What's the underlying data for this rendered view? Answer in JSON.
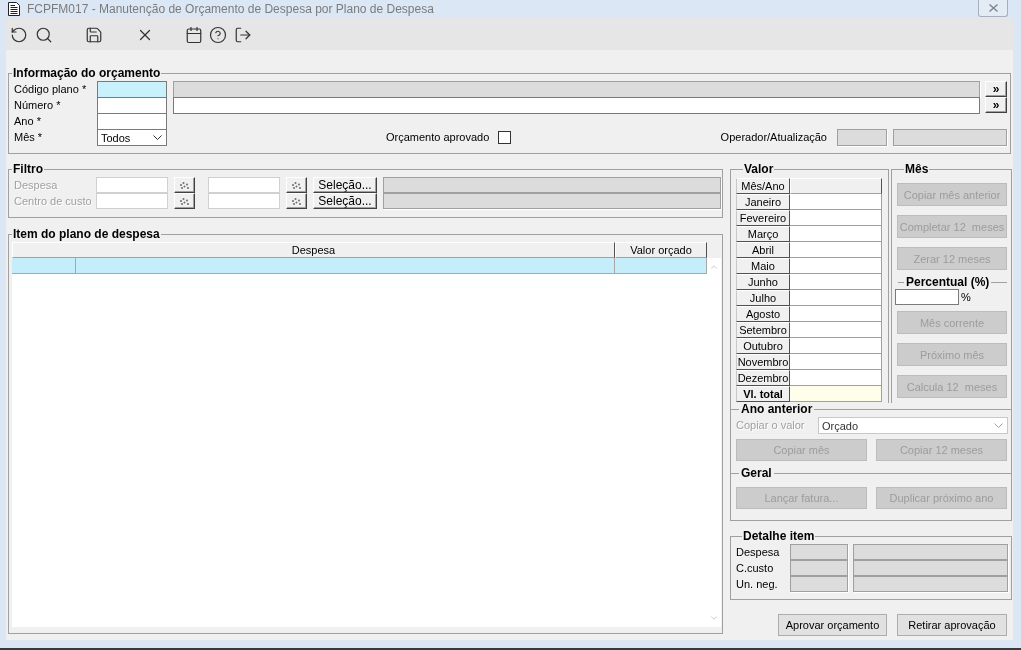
{
  "window": {
    "title": "FCPFM017 - Manutenção de Orçamento de Despesa por Plano de Despesa"
  },
  "info": {
    "title": "Informação do orçamento",
    "rows": [
      {
        "label": "Código plano *",
        "focused": true,
        "description": {
          "readonly": true
        },
        "lookup": "»"
      },
      {
        "label": "Número *",
        "focused": false,
        "description": {
          "readonly": false
        },
        "lookup": "»"
      },
      {
        "label": "Ano *",
        "focused": false
      }
    ],
    "month": {
      "label": "Mês *",
      "value": "Todos"
    },
    "approved": {
      "label": "Orçamento aprovado",
      "checked": false
    },
    "operator": {
      "label": "Operador/Atualização"
    }
  },
  "filter": {
    "title": "Filtro",
    "rows": [
      {
        "label": "Despesa",
        "disabled": true,
        "button": {
          "label": "Seleção...",
          "disabled": false
        }
      },
      {
        "label": "Centro de custo",
        "disabled": true,
        "button": {
          "label": "Seleção...",
          "disabled": false
        }
      }
    ]
  },
  "items": {
    "title": "Item do plano de despesa",
    "columns": [
      "Despesa",
      "Valor orçado"
    ],
    "rows": [
      {
        "selected": true
      }
    ]
  },
  "values": {
    "title": "Valor",
    "header": "Mês/Ano",
    "months": [
      "Janeiro",
      "Fevereiro",
      "Março",
      "Abril",
      "Maio",
      "Junho",
      "Julho",
      "Agosto",
      "Setembro",
      "Outubro",
      "Novembro",
      "Dezembro"
    ],
    "total_label": "Vl. total"
  },
  "month_actions": {
    "title": "Mês",
    "buttons": [
      {
        "label": "Copiar mês anterior",
        "disabled": true
      },
      {
        "label": "Completar 12  meses",
        "disabled": true
      },
      {
        "label": "Zerar 12 meses",
        "disabled": true
      }
    ],
    "percent": {
      "title": "Percentual (%)",
      "unit": "%"
    },
    "percent_buttons": [
      {
        "label": "Mês corrente",
        "disabled": true
      },
      {
        "label": "Próximo mês",
        "disabled": true
      },
      {
        "label": "Calcula 12  meses",
        "disabled": true
      }
    ]
  },
  "previous_year": {
    "title": "Ano anterior",
    "copy": {
      "label": "Copiar o valor",
      "value": "Orçado",
      "disabled": true
    },
    "buttons": [
      {
        "label": "Copiar mês",
        "disabled": true
      },
      {
        "label": "Copiar 12 meses",
        "disabled": true
      }
    ]
  },
  "general": {
    "title": "Geral",
    "buttons": [
      {
        "label": "Lançar fatura...",
        "disabled": true
      },
      {
        "label": "Duplicar próximo ano",
        "disabled": true
      }
    ]
  },
  "detail": {
    "title": "Detalhe item",
    "rows": [
      "Despesa",
      "C.custo",
      "Un. neg."
    ]
  },
  "actions": [
    {
      "label": "Aprovar orçamento",
      "disabled": false
    },
    {
      "label": "Retirar aprovação",
      "disabled": false
    }
  ]
}
